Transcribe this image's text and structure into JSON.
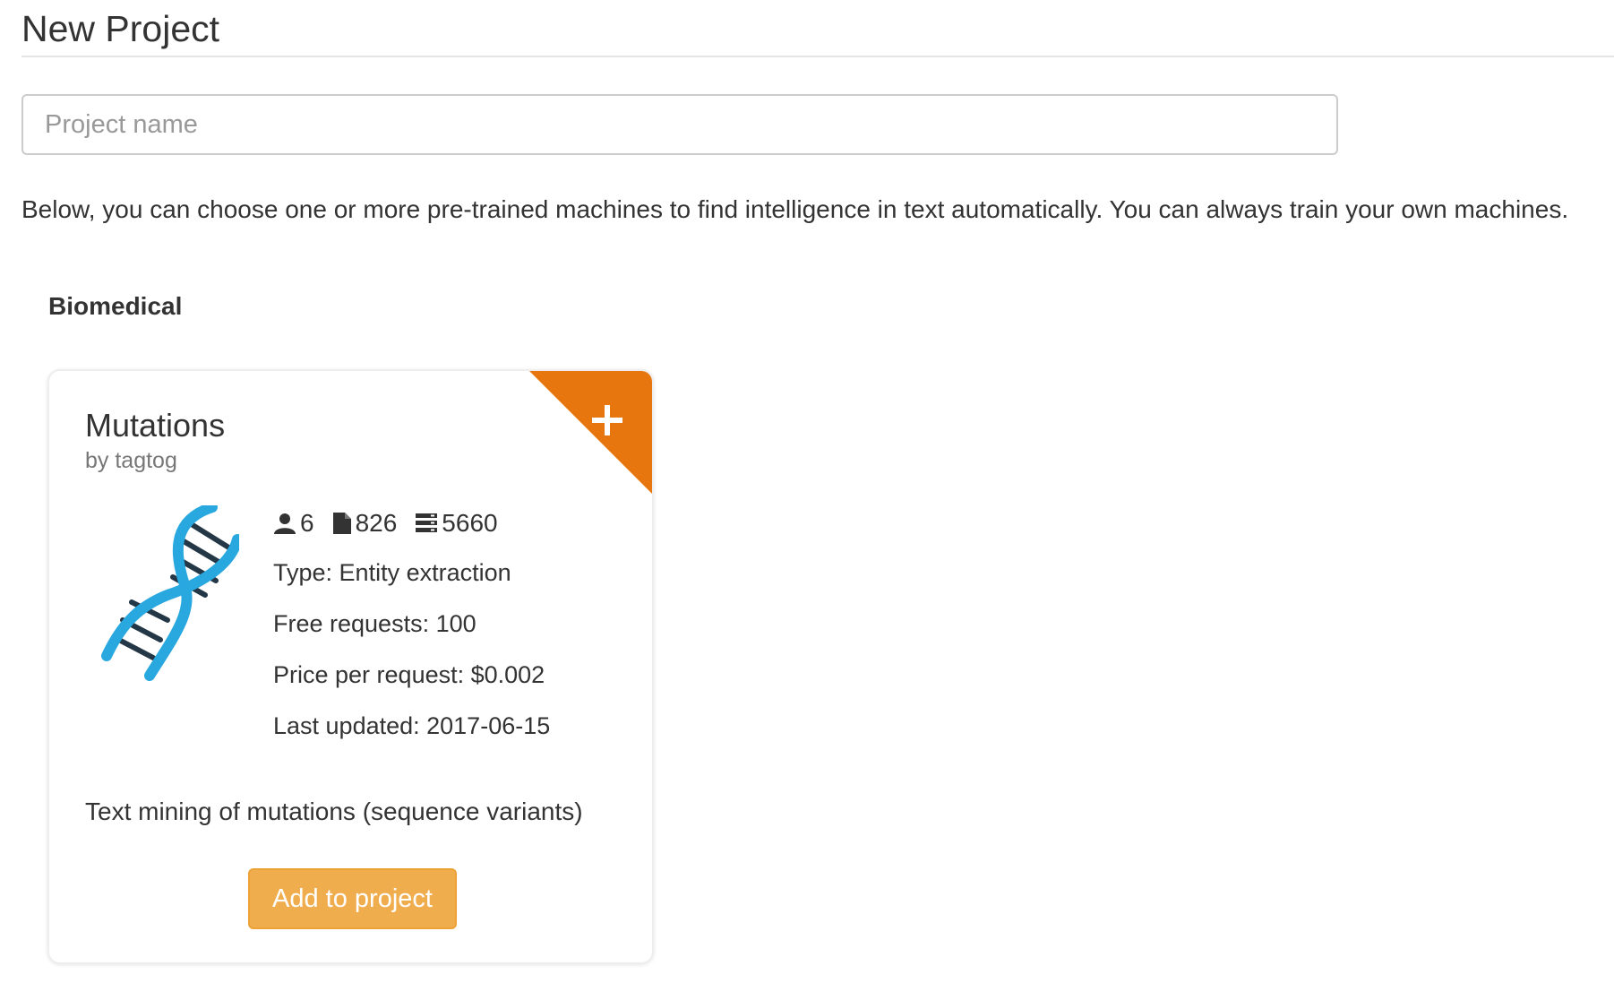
{
  "header": {
    "title": "New Project"
  },
  "project_name": {
    "value": "",
    "placeholder": "Project name"
  },
  "intro_text": "Below, you can choose one or more pre-trained machines to find intelligence in text automatically. You can always train your own machines.",
  "categories": [
    {
      "label": "Biomedical",
      "machines": [
        {
          "title": "Mutations",
          "author": "by tagtog",
          "corner_icon": "plus-icon",
          "image_icon": "dna-icon",
          "stats": {
            "members": "6",
            "documents": "826",
            "entities": "5660"
          },
          "stat_icons": [
            "user-icon",
            "document-icon",
            "database-icon"
          ],
          "type": "Type: Entity extraction",
          "free_requests": "Free requests: 100",
          "price": "Price per request: $0.002",
          "last_updated": "Last updated: 2017-06-15",
          "description": "Text mining of mutations (sequence variants)",
          "button_label": "Add to project"
        }
      ]
    }
  ],
  "colors": {
    "accent": "#e8760f",
    "button": "#f0ad4e",
    "dna_strand": "#29a8e0",
    "dna_rungs": "#243746"
  }
}
